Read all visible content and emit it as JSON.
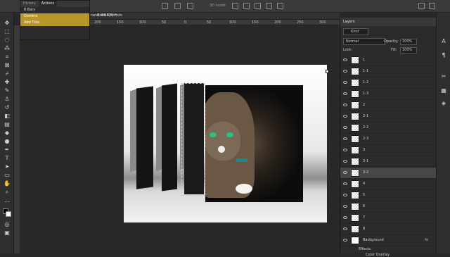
{
  "app": {
    "title": "Photoshop"
  },
  "topbar": {
    "zoom_hint": "3D mode"
  },
  "document": {
    "tab_label": "-2, RGB/8) *",
    "command": "ransform Controls"
  },
  "ruler": {
    "ticks": [
      "200",
      "150",
      "100",
      "50",
      "0",
      "50",
      "100",
      "150",
      "200",
      "250",
      "300",
      "350",
      "400",
      "450",
      "50"
    ]
  },
  "actions_panel": {
    "tabs": [
      "History",
      "Actions"
    ],
    "active_tab": "Actions",
    "items": [
      {
        "label": "8 Bars",
        "selected": false
      },
      {
        "label": "Domino",
        "selected": true
      },
      {
        "label": "Add Tiles",
        "selected": true
      }
    ]
  },
  "layers_panel": {
    "title": "Layers",
    "filter": "Kind",
    "blend_mode": "Normal",
    "opacity_label": "Opacity:",
    "opacity": "100%",
    "lock_label": "Lock:",
    "fill_label": "Fill:",
    "fill": "100%",
    "layers": [
      {
        "name": "1",
        "selected": false
      },
      {
        "name": "1-1",
        "selected": false
      },
      {
        "name": "1-2",
        "selected": false
      },
      {
        "name": "1-3",
        "selected": false
      },
      {
        "name": "2",
        "selected": false
      },
      {
        "name": "2-1",
        "selected": false
      },
      {
        "name": "2-2",
        "selected": false
      },
      {
        "name": "2-3",
        "selected": false
      },
      {
        "name": "3",
        "selected": false
      },
      {
        "name": "3-1",
        "selected": false
      },
      {
        "name": "3-2",
        "selected": true
      },
      {
        "name": "4",
        "selected": false
      },
      {
        "name": "5",
        "selected": false
      },
      {
        "name": "6",
        "selected": false
      },
      {
        "name": "7",
        "selected": false
      },
      {
        "name": "8",
        "selected": false
      },
      {
        "name": "Background",
        "selected": false,
        "fx": "fx"
      }
    ],
    "effects_label": "Effects",
    "color_overlay_label": "Color Overlay"
  }
}
